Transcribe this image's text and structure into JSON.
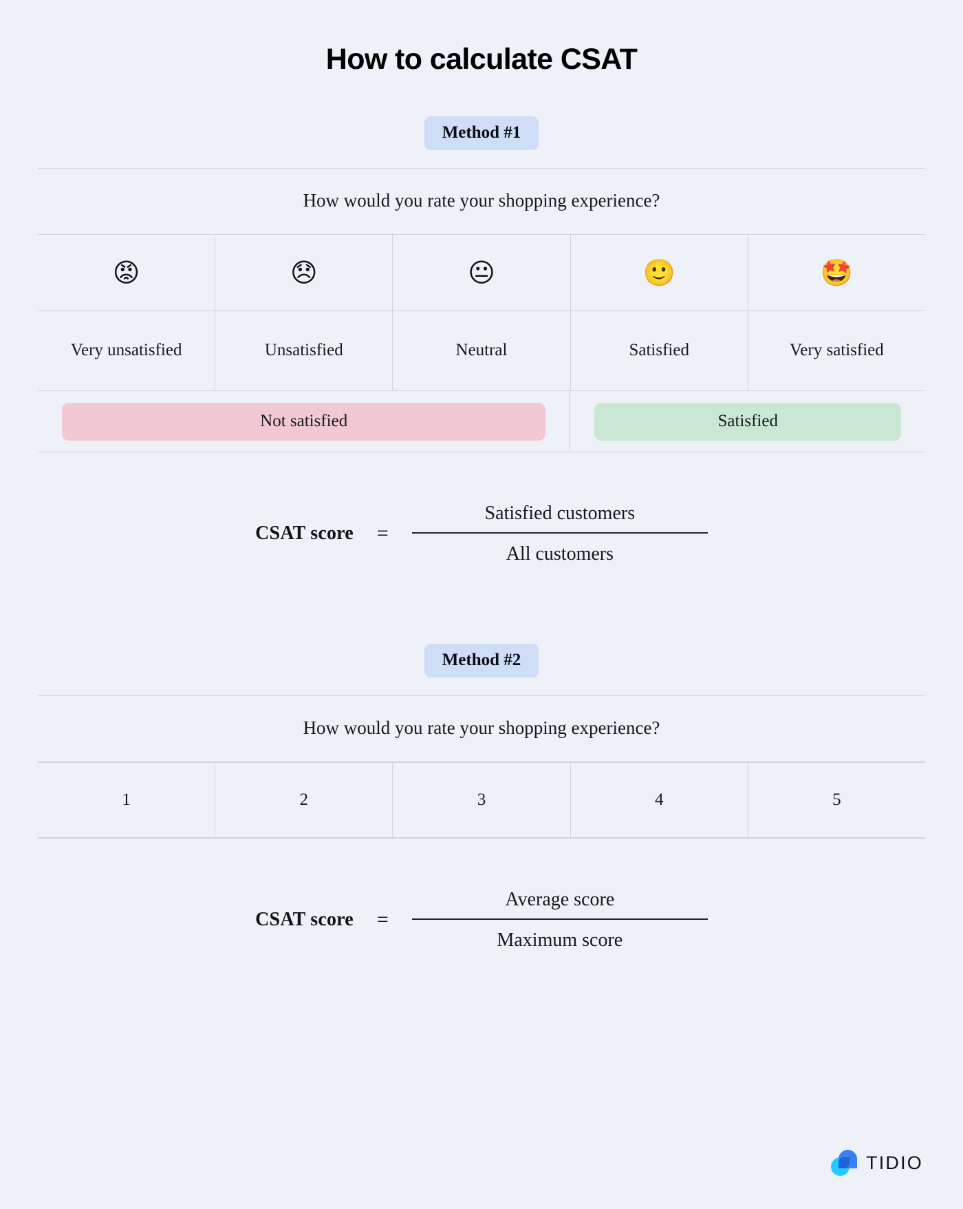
{
  "title": "How to calculate CSAT",
  "method1": {
    "badge": "Method #1",
    "question": "How would you rate your shopping experience?",
    "options": [
      {
        "emoji": "😡",
        "emoji_name": "pouting-face-emoji",
        "label": "Very unsatisfied"
      },
      {
        "emoji": "😞",
        "emoji_name": "disappointed-face-emoji",
        "label": "Unsatisfied"
      },
      {
        "emoji": "😐",
        "emoji_name": "neutral-face-emoji",
        "label": "Neutral"
      },
      {
        "emoji": "🙂",
        "emoji_name": "slightly-smiling-face-emoji",
        "label": "Satisfied"
      },
      {
        "emoji": "🤩",
        "emoji_name": "star-struck-face-emoji",
        "label": "Very satisfied"
      }
    ],
    "groups": [
      {
        "label": "Not satisfied",
        "color": "#f2c8d2"
      },
      {
        "label": "Satisfied",
        "color": "#cae7d4"
      }
    ],
    "formula": {
      "label": "CSAT score",
      "equals": "=",
      "numerator": "Satisfied customers",
      "denominator": "All customers"
    }
  },
  "method2": {
    "badge": "Method #2",
    "question": "How would you rate your shopping experience?",
    "scale": [
      "1",
      "2",
      "3",
      "4",
      "5"
    ],
    "formula": {
      "label": "CSAT score",
      "equals": "=",
      "numerator": "Average score",
      "denominator": "Maximum score"
    }
  },
  "branding": {
    "name": "TIDIO",
    "accent_blue": "#3c7ef3",
    "accent_cyan": "#22ccff"
  },
  "theme": {
    "background": "#eef1f7",
    "badge_background": "#cedef7",
    "grid_line": "#ccd5e2",
    "text": "#141821"
  }
}
